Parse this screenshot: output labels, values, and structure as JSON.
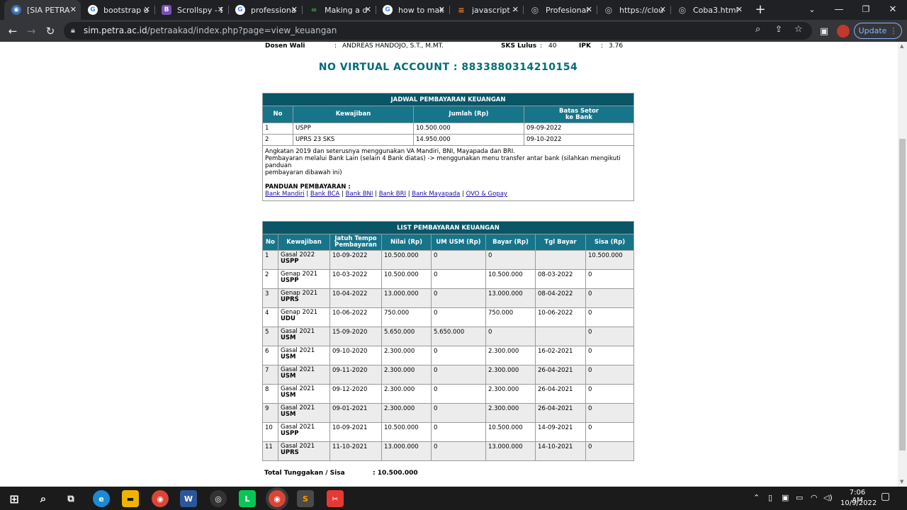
{
  "browser": {
    "tabs": [
      {
        "label": "[SIA PETRA",
        "icon": "sia-icon",
        "active": true
      },
      {
        "label": "bootstrap u",
        "icon": "google-icon"
      },
      {
        "label": "Scrollspy - B",
        "icon": "bootstrap-icon"
      },
      {
        "label": "professiona",
        "icon": "google-icon"
      },
      {
        "label": "Making a d",
        "icon": "codepen-icon"
      },
      {
        "label": "how to mak",
        "icon": "google-icon"
      },
      {
        "label": "javascript -",
        "icon": "stackoverflow-icon"
      },
      {
        "label": "Profesional",
        "icon": "globe-icon"
      },
      {
        "label": "https://clou",
        "icon": "globe-icon"
      },
      {
        "label": "Coba3.html",
        "icon": "globe-icon"
      }
    ],
    "new_tab": "+",
    "url_host": "sim.petra.ac.id",
    "url_path": "/petraakad/index.php?page=view_keuangan",
    "update_label": "Update"
  },
  "student_info": {
    "dosen_label": "Dosen Wali",
    "dosen_sep": ":",
    "dosen_value": "ANDREAS HANDOJO, S.T., M.MT.",
    "sks_label": "SKS Lulus",
    "sks_sep": ":",
    "sks_value": "40",
    "ipk_label": "IPK",
    "ipk_sep": ":",
    "ipk_value": "3.76"
  },
  "virtual_account": "NO VIRTUAL ACCOUNT : 8833880314210154",
  "schedule": {
    "title": "JADWAL PEMBAYARAN KEUANGAN",
    "headers": [
      "No",
      "Kewajiban",
      "Jumlah (Rp)",
      "Batas Setor",
      "ke Bank"
    ],
    "rows": [
      [
        "1",
        "USPP",
        "10.500.000",
        "09-09-2022"
      ],
      [
        "2",
        "UPRS 23 SKS",
        "14.950.000",
        "09-10-2022"
      ]
    ],
    "note1": "Angkatan 2019 dan seterusnya menggunakan VA Mandiri, BNI, Mayapada dan BRI.",
    "note2": "Pembayaran melalui Bank Lain (selain 4 Bank diatas) -> menggunakan menu transfer antar bank (silahkan mengikuti panduan",
    "note3": "pembayaran dibawah ini)",
    "guide_title": "PANDUAN PEMBAYARAN :",
    "links": [
      "Bank Mandiri",
      "Bank BCA",
      "Bank BNI",
      "Bank BRI",
      "Bank Mayapada",
      "OVO & Gopay"
    ],
    "link_sep": "|"
  },
  "payments": {
    "title": "LIST PEMBAYARAN KEUANGAN",
    "headers": [
      "No",
      "Kewajiban",
      "Jatuh Tempo",
      "Pembayaran",
      "Nilai (Rp)",
      "UM USM (Rp)",
      "Bayar (Rp)",
      "Tgl Bayar",
      "Sisa (Rp)"
    ],
    "rows": [
      {
        "no": "1",
        "sem": "Gasal 2022",
        "kode": "USPP",
        "jatuh": "10-09-2022",
        "nilai": "10.500.000",
        "um": "0",
        "bayar": "0",
        "tgl": "",
        "sisa": "10.500.000"
      },
      {
        "no": "2",
        "sem": "Genap 2021",
        "kode": "USPP",
        "jatuh": "10-03-2022",
        "nilai": "10.500.000",
        "um": "0",
        "bayar": "10.500.000",
        "tgl": "08-03-2022",
        "sisa": "0"
      },
      {
        "no": "3",
        "sem": "Genap 2021",
        "kode": "UPRS",
        "jatuh": "10-04-2022",
        "nilai": "13.000.000",
        "um": "0",
        "bayar": "13.000.000",
        "tgl": "08-04-2022",
        "sisa": "0"
      },
      {
        "no": "4",
        "sem": "Genap 2021",
        "kode": "UDU",
        "jatuh": "10-06-2022",
        "nilai": "750.000",
        "um": "0",
        "bayar": "750.000",
        "tgl": "10-06-2022",
        "sisa": "0"
      },
      {
        "no": "5",
        "sem": "Gasal 2021",
        "kode": "USM",
        "jatuh": "15-09-2020",
        "nilai": "5.650.000",
        "um": "5.650.000",
        "bayar": "0",
        "tgl": "",
        "sisa": "0"
      },
      {
        "no": "6",
        "sem": "Gasal 2021",
        "kode": "USM",
        "jatuh": "09-10-2020",
        "nilai": "2.300.000",
        "um": "0",
        "bayar": "2.300.000",
        "tgl": "16-02-2021",
        "sisa": "0"
      },
      {
        "no": "7",
        "sem": "Gasal 2021",
        "kode": "USM",
        "jatuh": "09-11-2020",
        "nilai": "2.300.000",
        "um": "0",
        "bayar": "2.300.000",
        "tgl": "26-04-2021",
        "sisa": "0"
      },
      {
        "no": "8",
        "sem": "Gasal 2021",
        "kode": "USM",
        "jatuh": "09-12-2020",
        "nilai": "2.300.000",
        "um": "0",
        "bayar": "2.300.000",
        "tgl": "26-04-2021",
        "sisa": "0"
      },
      {
        "no": "9",
        "sem": "Gasal 2021",
        "kode": "USM",
        "jatuh": "09-01-2021",
        "nilai": "2.300.000",
        "um": "0",
        "bayar": "2.300.000",
        "tgl": "26-04-2021",
        "sisa": "0"
      },
      {
        "no": "10",
        "sem": "Gasal 2021",
        "kode": "USPP",
        "jatuh": "10-09-2021",
        "nilai": "10.500.000",
        "um": "0",
        "bayar": "10.500.000",
        "tgl": "14-09-2021",
        "sisa": "0"
      },
      {
        "no": "11",
        "sem": "Gasal 2021",
        "kode": "UPRS",
        "jatuh": "11-10-2021",
        "nilai": "13.000.000",
        "um": "0",
        "bayar": "13.000.000",
        "tgl": "14-10-2021",
        "sisa": "0"
      }
    ],
    "total_label": "Total Tunggakan / Sisa",
    "total_value": ": 10.500.000"
  },
  "taskbar": {
    "apps": [
      "start-icon",
      "search-icon",
      "task-view-icon",
      "edge-icon",
      "file-explorer-icon",
      "chrome-icon",
      "word-icon",
      "obs-icon",
      "line-icon",
      "chrome-icon",
      "sublime-icon",
      "snipping-icon"
    ],
    "time": "7:06 AM",
    "date": "10/9/2022"
  },
  "colors": {
    "table_caption": "#0a5566",
    "table_header": "#17758a",
    "va_text": "#006c77"
  }
}
